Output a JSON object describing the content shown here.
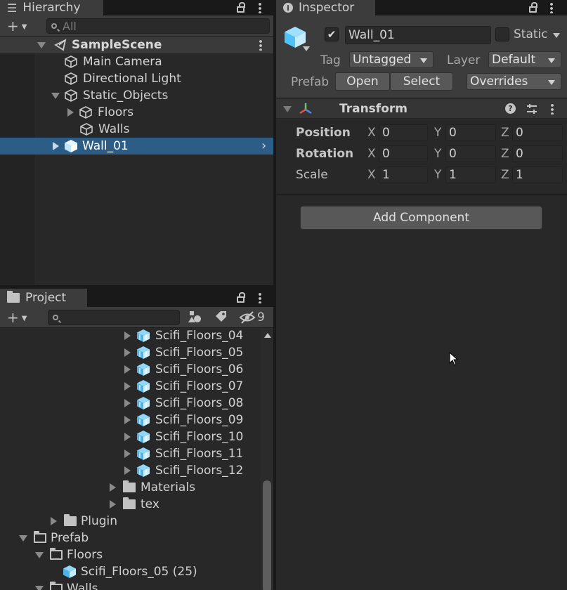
{
  "hierarchy": {
    "tab_title": "Hierarchy",
    "search_placeholder": "All",
    "scene_name": "SampleScene",
    "items": [
      {
        "label": "Main Camera"
      },
      {
        "label": "Directional Light"
      },
      {
        "label": "Static_Objects"
      },
      {
        "label": "Floors"
      },
      {
        "label": "Walls"
      },
      {
        "label": "Wall_01"
      }
    ]
  },
  "project": {
    "tab_title": "Project",
    "search_value": "",
    "hidden_count": "9",
    "items": [
      {
        "label": "Scifi_Floors_04"
      },
      {
        "label": "Scifi_Floors_05"
      },
      {
        "label": "Scifi_Floors_06"
      },
      {
        "label": "Scifi_Floors_07"
      },
      {
        "label": "Scifi_Floors_08"
      },
      {
        "label": "Scifi_Floors_09"
      },
      {
        "label": "Scifi_Floors_10"
      },
      {
        "label": "Scifi_Floors_11"
      },
      {
        "label": "Scifi_Floors_12"
      },
      {
        "label": "Materials"
      },
      {
        "label": "tex"
      },
      {
        "label": "Plugin"
      },
      {
        "label": "Prefab"
      },
      {
        "label": "Floors"
      },
      {
        "label": "Scifi_Floors_05 (25)"
      },
      {
        "label": "Walls"
      }
    ]
  },
  "inspector": {
    "tab_title": "Inspector",
    "object_name": "Wall_01",
    "active": true,
    "static_label": "Static",
    "tag_label": "Tag",
    "tag_value": "Untagged",
    "layer_label": "Layer",
    "layer_value": "Default",
    "prefab_label": "Prefab",
    "open_label": "Open",
    "select_label": "Select",
    "overrides_label": "Overrides",
    "transform": {
      "title": "Transform",
      "rows": [
        {
          "label": "Position",
          "x": "0",
          "y": "0",
          "z": "0"
        },
        {
          "label": "Rotation",
          "x": "0",
          "y": "0",
          "z": "0"
        },
        {
          "label": "Scale",
          "x": "1",
          "y": "1",
          "z": "1"
        }
      ],
      "axis_x": "X",
      "axis_y": "Y",
      "axis_z": "Z"
    },
    "add_component_label": "Add Component"
  },
  "colors": {
    "selection": "#2c5d87",
    "accent_blue": "#4fc3f7"
  }
}
